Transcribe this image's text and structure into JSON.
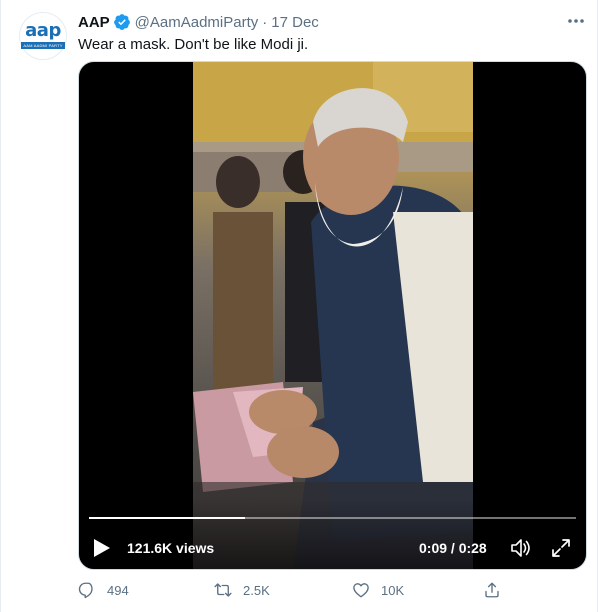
{
  "tweet": {
    "author_name": "AAP",
    "handle": "@AamAadmiParty",
    "separator": "·",
    "date": "17 Dec",
    "text": "Wear a mask. Don't be like Modi ji.",
    "avatar": {
      "logo_text": "aap",
      "logo_subtext": "AAM AADMI PARTY"
    }
  },
  "video": {
    "views": "121.6K views",
    "time": "0:09 / 0:28",
    "progress_fraction": 0.32
  },
  "actions": {
    "reply_count": "494",
    "retweet_count": "2.5K",
    "like_count": "10K"
  },
  "icons": {
    "verified": "verified-badge-icon",
    "more": "more-options-icon",
    "play": "play-icon",
    "volume": "volume-icon",
    "fullscreen": "fullscreen-icon",
    "reply": "reply-icon",
    "retweet": "retweet-icon",
    "like": "like-icon",
    "share": "share-icon"
  },
  "colors": {
    "brand_blue": "#1d9bf0",
    "secondary_text": "#5b7083",
    "avatar_blue": "#1b6fb5"
  }
}
